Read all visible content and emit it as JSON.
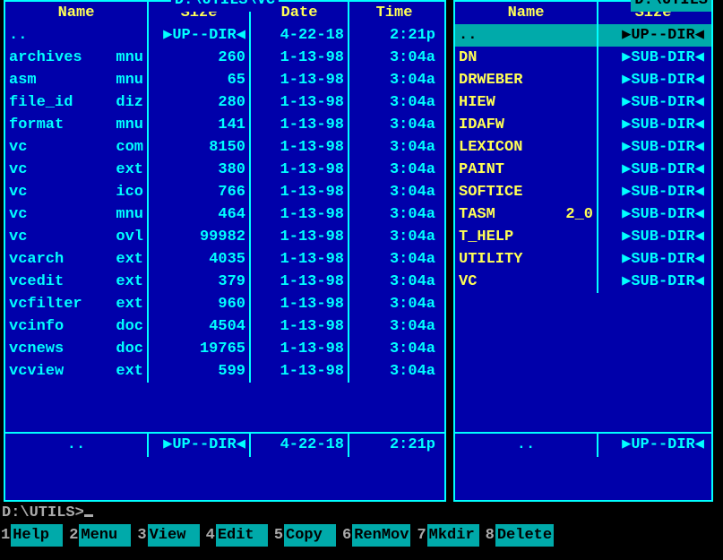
{
  "left_panel": {
    "title": "D:\\UTILS\\VC",
    "headers": {
      "name": "Name",
      "size": "Size",
      "date": "Date",
      "time": "Time"
    },
    "rows": [
      {
        "name": "..",
        "ext": "",
        "size": "▶UP--DIR◀",
        "is_marker": true,
        "date": "4-22-18",
        "time": "2:21p"
      },
      {
        "name": "archives",
        "ext": "mnu",
        "size": "260",
        "date": "1-13-98",
        "time": "3:04a"
      },
      {
        "name": "asm",
        "ext": "mnu",
        "size": "65",
        "date": "1-13-98",
        "time": "3:04a"
      },
      {
        "name": "file_id",
        "ext": "diz",
        "size": "280",
        "date": "1-13-98",
        "time": "3:04a"
      },
      {
        "name": "format",
        "ext": "mnu",
        "size": "141",
        "date": "1-13-98",
        "time": "3:04a"
      },
      {
        "name": "vc",
        "ext": "com",
        "size": "8150",
        "date": "1-13-98",
        "time": "3:04a"
      },
      {
        "name": "vc",
        "ext": "ext",
        "size": "380",
        "date": "1-13-98",
        "time": "3:04a"
      },
      {
        "name": "vc",
        "ext": "ico",
        "size": "766",
        "date": "1-13-98",
        "time": "3:04a"
      },
      {
        "name": "vc",
        "ext": "mnu",
        "size": "464",
        "date": "1-13-98",
        "time": "3:04a"
      },
      {
        "name": "vc",
        "ext": "ovl",
        "size": "99982",
        "date": "1-13-98",
        "time": "3:04a"
      },
      {
        "name": "vcarch",
        "ext": "ext",
        "size": "4035",
        "date": "1-13-98",
        "time": "3:04a"
      },
      {
        "name": "vcedit",
        "ext": "ext",
        "size": "379",
        "date": "1-13-98",
        "time": "3:04a"
      },
      {
        "name": "vcfilter",
        "ext": "ext",
        "size": "960",
        "date": "1-13-98",
        "time": "3:04a"
      },
      {
        "name": "vcinfo",
        "ext": "doc",
        "size": "4504",
        "date": "1-13-98",
        "time": "3:04a"
      },
      {
        "name": "vcnews",
        "ext": "doc",
        "size": "19765",
        "date": "1-13-98",
        "time": "3:04a"
      },
      {
        "name": "vcview",
        "ext": "ext",
        "size": "599",
        "date": "1-13-98",
        "time": "3:04a"
      }
    ],
    "status": {
      "name": "..",
      "size": "▶UP--DIR◀",
      "date": "4-22-18",
      "time": "2:21p"
    }
  },
  "right_panel": {
    "title": "D:\\UTILS",
    "headers": {
      "name": "Name",
      "size": "Size"
    },
    "selected_index": 0,
    "rows": [
      {
        "name": "..",
        "ext": "",
        "size": "▶UP--DIR◀",
        "is_marker": true,
        "yellow": false
      },
      {
        "name": "DN",
        "ext": "",
        "size": "▶SUB-DIR◀",
        "is_marker": true,
        "yellow": true
      },
      {
        "name": "DRWEBER",
        "ext": "",
        "size": "▶SUB-DIR◀",
        "is_marker": true,
        "yellow": true
      },
      {
        "name": "HIEW",
        "ext": "",
        "size": "▶SUB-DIR◀",
        "is_marker": true,
        "yellow": true
      },
      {
        "name": "IDAFW",
        "ext": "",
        "size": "▶SUB-DIR◀",
        "is_marker": true,
        "yellow": true
      },
      {
        "name": "LEXICON",
        "ext": "",
        "size": "▶SUB-DIR◀",
        "is_marker": true,
        "yellow": true
      },
      {
        "name": "PAINT",
        "ext": "",
        "size": "▶SUB-DIR◀",
        "is_marker": true,
        "yellow": true
      },
      {
        "name": "SOFTICE",
        "ext": "",
        "size": "▶SUB-DIR◀",
        "is_marker": true,
        "yellow": true
      },
      {
        "name": "TASM",
        "ext": "2_0",
        "size": "▶SUB-DIR◀",
        "is_marker": true,
        "yellow": true
      },
      {
        "name": "T_HELP",
        "ext": "",
        "size": "▶SUB-DIR◀",
        "is_marker": true,
        "yellow": true
      },
      {
        "name": "UTILITY",
        "ext": "",
        "size": "▶SUB-DIR◀",
        "is_marker": true,
        "yellow": true
      },
      {
        "name": "VC",
        "ext": "",
        "size": "▶SUB-DIR◀",
        "is_marker": true,
        "yellow": true
      }
    ],
    "status": {
      "name": "..",
      "size": "▶UP--DIR◀"
    }
  },
  "prompt": "D:\\UTILS>",
  "fkeys": [
    {
      "num": "1",
      "label": "Help"
    },
    {
      "num": "2",
      "label": "Menu"
    },
    {
      "num": "3",
      "label": "View"
    },
    {
      "num": "4",
      "label": "Edit"
    },
    {
      "num": "5",
      "label": "Copy"
    },
    {
      "num": "6",
      "label": "RenMov"
    },
    {
      "num": "7",
      "label": "Mkdir"
    },
    {
      "num": "8",
      "label": "Delete"
    }
  ]
}
